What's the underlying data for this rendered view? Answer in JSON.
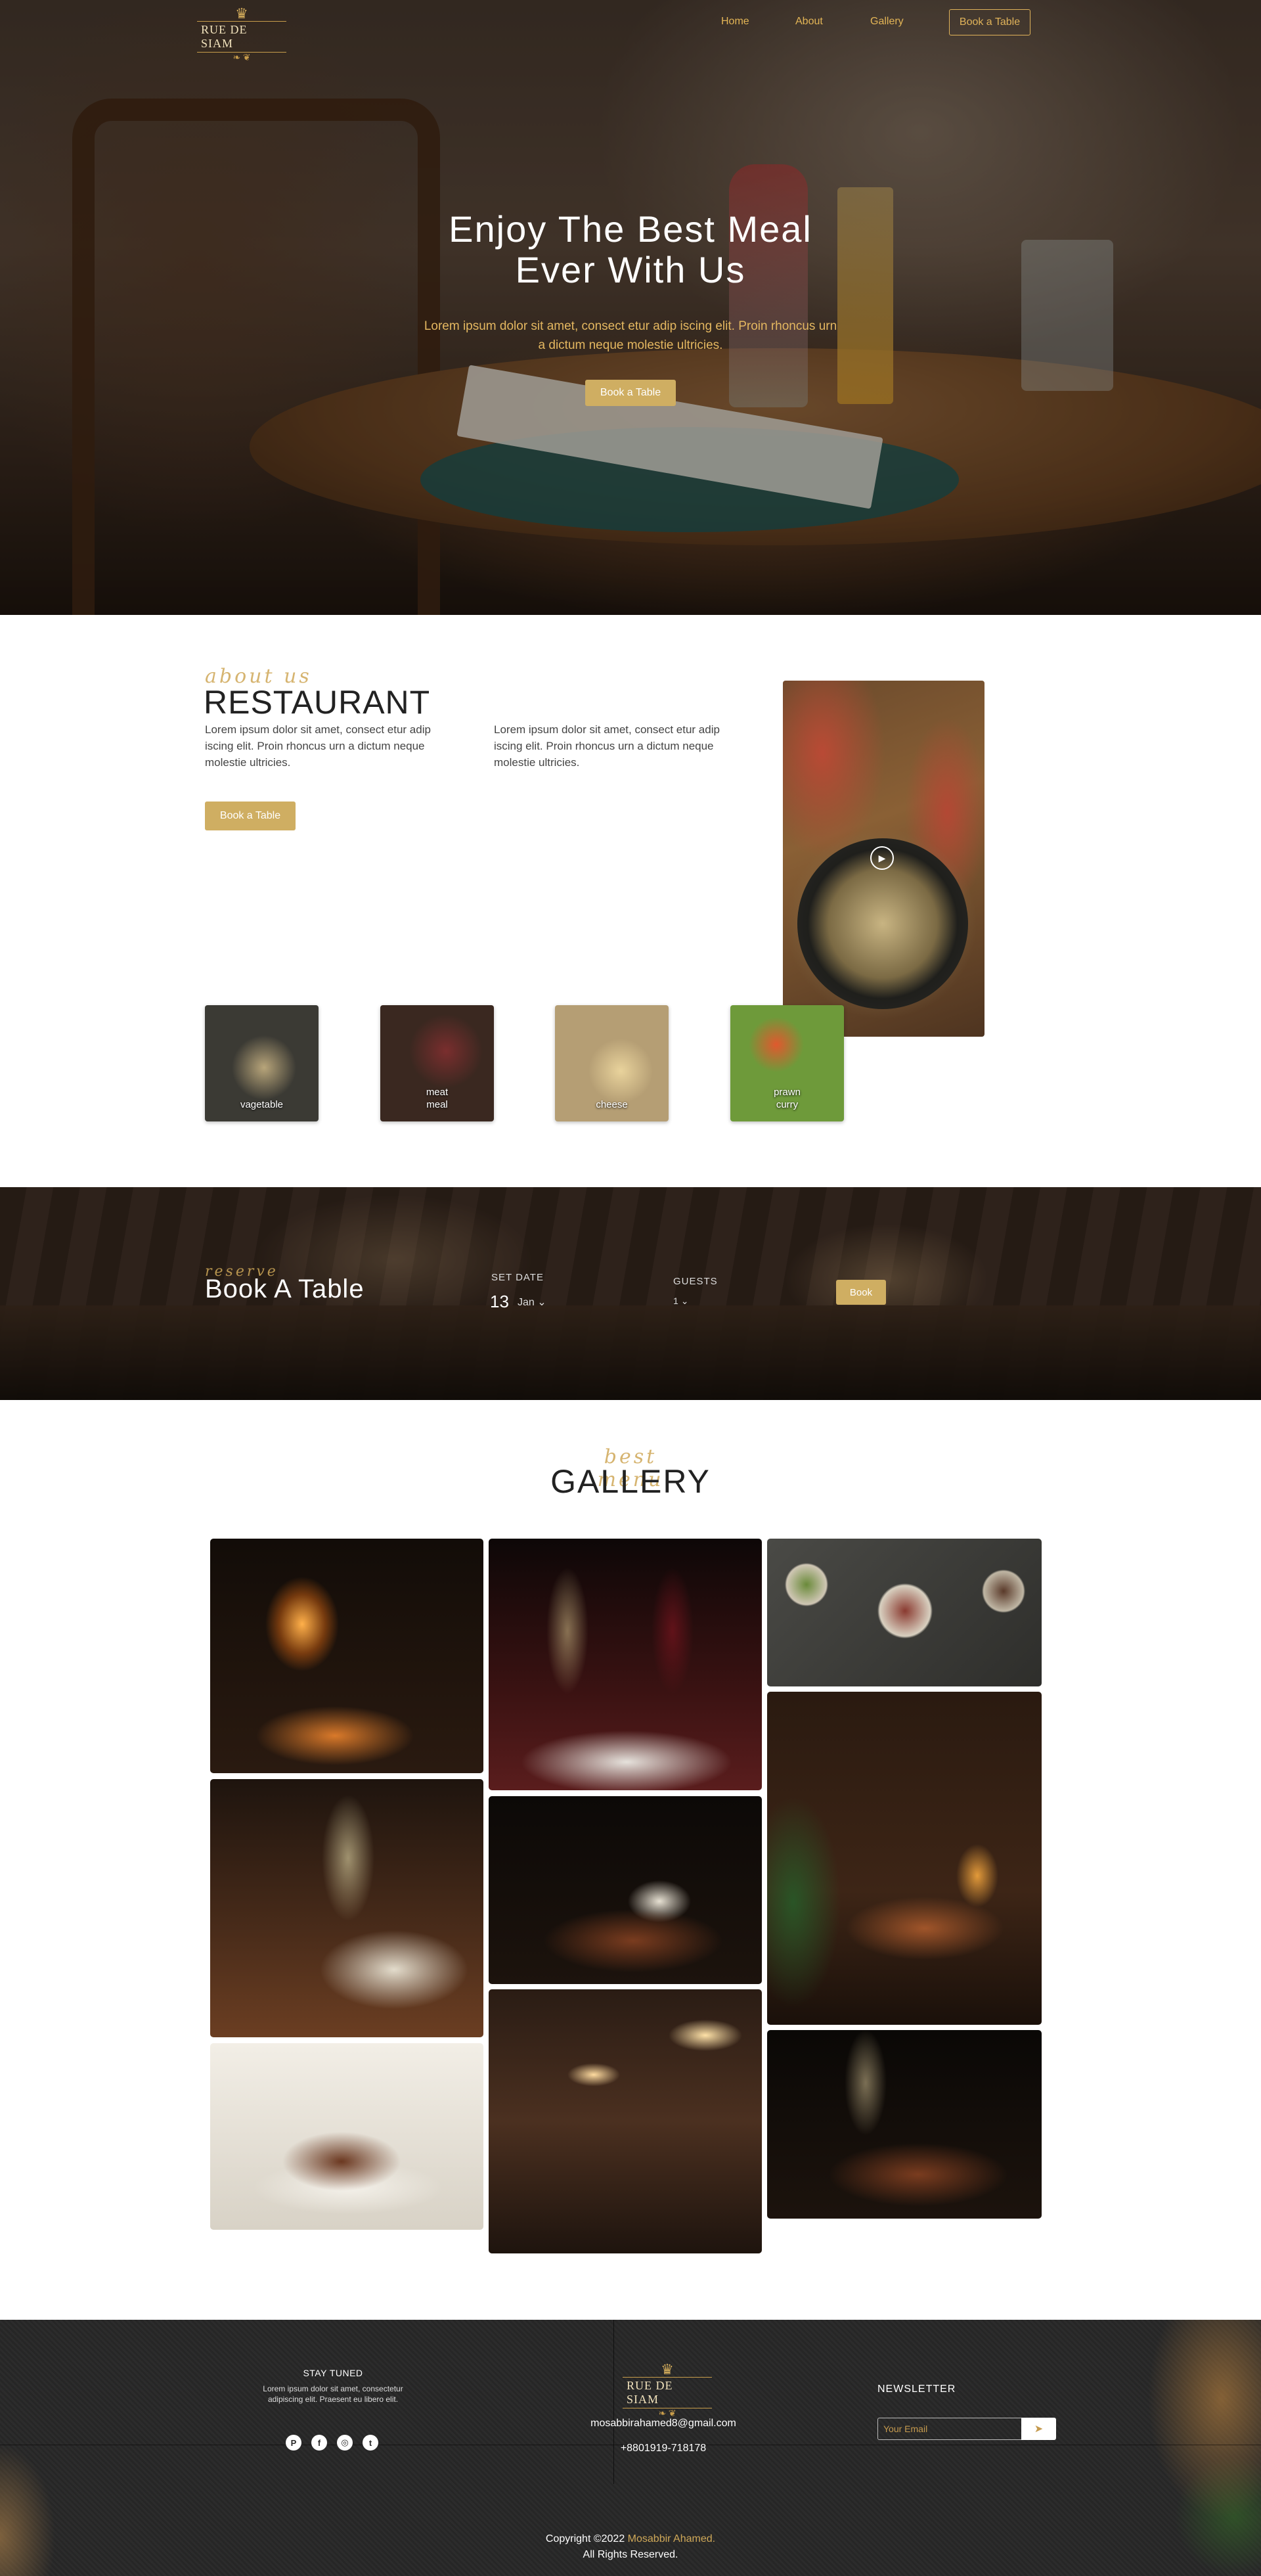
{
  "nav": {
    "logo": "RUE DE SIAM",
    "links": [
      "Home",
      "About",
      "Gallery"
    ],
    "cta": "Book a Table"
  },
  "hero": {
    "title_line1": "Enjoy The Best Meal",
    "title_line2": "Ever With Us",
    "subtitle": "Lorem ipsum dolor sit amet, consect etur adip iscing elit. Proin rhoncus urn a dictum neque molestie ultricies.",
    "button": "Book a Table"
  },
  "about": {
    "script": "about us",
    "title": "RESTAURANT",
    "para1": "Lorem ipsum dolor sit amet, consect etur adip iscing elit. Proin rhoncus urn a dictum neque molestie ultricies.",
    "para2": "Lorem ipsum dolor sit amet, consect etur adip iscing elit. Proin rhoncus urn a dictum neque molestie ultricies.",
    "button": "Book a Table",
    "dishes": [
      {
        "label1": "vagetable",
        "label2": ""
      },
      {
        "label1": "meat",
        "label2": "meal"
      },
      {
        "label1": "cheese",
        "label2": ""
      },
      {
        "label1": "prawn",
        "label2": "curry"
      }
    ]
  },
  "booking": {
    "script": "reserve",
    "title": "Book A Table",
    "date_label": "SET DATE",
    "date_day": "13",
    "date_month": "Jan",
    "guests_label": "GUESTS",
    "guests_value": "1",
    "button": "Book"
  },
  "gallery": {
    "script": "best menu",
    "title": "GALLERY"
  },
  "footer": {
    "stay_title": "STAY TUNED",
    "stay_text": "Lorem ipsum dolor sit amet, consectetur adipiscing elit. Praesent eu libero elit.",
    "social": [
      "pinterest-icon",
      "facebook-icon",
      "instagram-icon",
      "twitter-icon"
    ],
    "logo": "RUE DE SIAM",
    "email": "mosabbirahamed8@gmail.com",
    "phone": "+8801919-718178",
    "newsletter_title": "NEWSLETTER",
    "newsletter_placeholder": "Your Email",
    "copyright_prefix": "Copyright ©2022",
    "copyright_name": "Mosabbir Ahamed.",
    "copyright_suffix": "All Rights Reserved."
  },
  "colors": {
    "accent": "#cfae62",
    "gold_text": "#e3b556",
    "footer_bg": "#2a2a2a"
  }
}
